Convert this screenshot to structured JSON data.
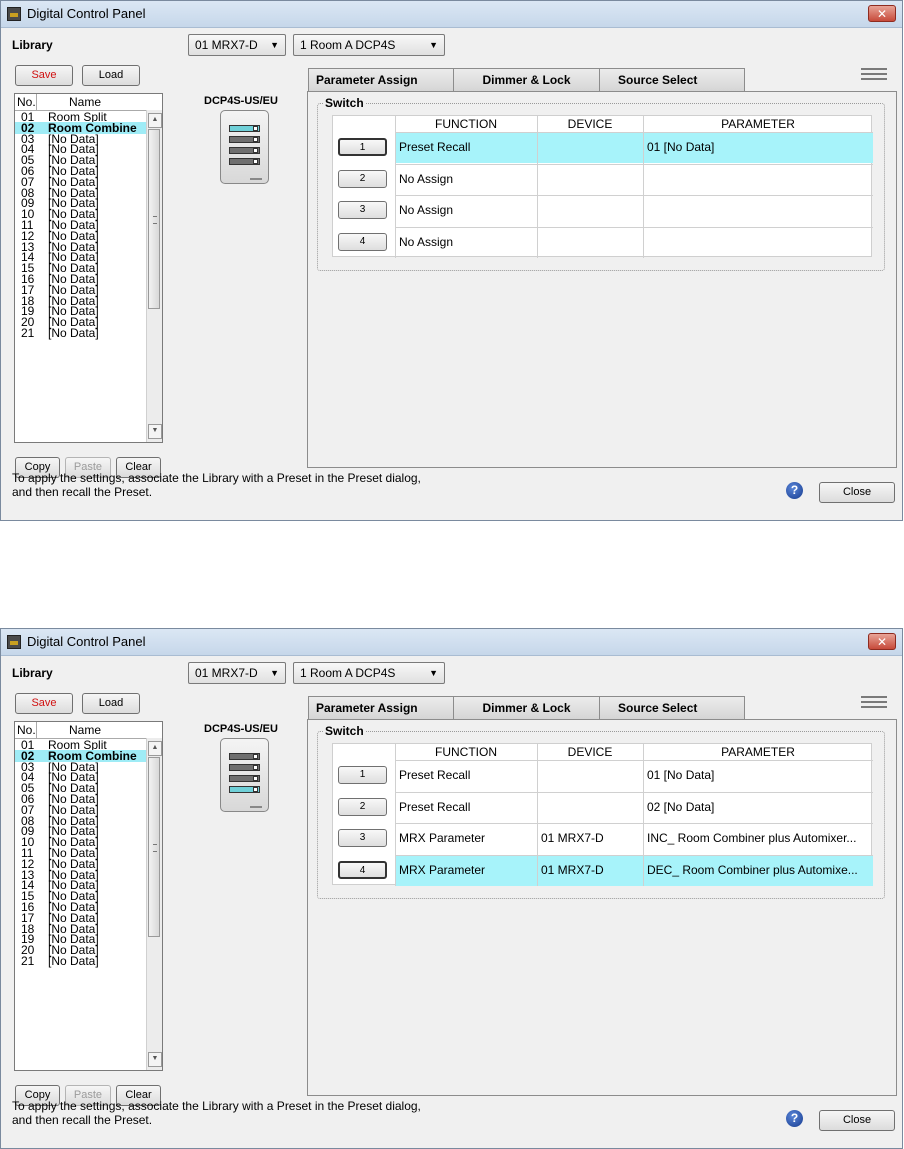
{
  "dialogs": [
    {
      "window_title": "Digital Control Panel",
      "library_label": "Library",
      "buttons": {
        "save": "Save",
        "load": "Load",
        "copy": "Copy",
        "paste": "Paste",
        "clear": "Clear",
        "close": "Close"
      },
      "combo_device": "01 MRX7-D",
      "combo_panel": "1 Room A DCP4S",
      "list_header": {
        "no": "No.",
        "name": "Name"
      },
      "library_items": [
        {
          "no": "01",
          "name": "Room Split"
        },
        {
          "no": "02",
          "name": "Room Combine"
        },
        {
          "no": "03",
          "name": "[No Data]"
        },
        {
          "no": "04",
          "name": "[No Data]"
        },
        {
          "no": "05",
          "name": "[No Data]"
        },
        {
          "no": "06",
          "name": "[No Data]"
        },
        {
          "no": "07",
          "name": "[No Data]"
        },
        {
          "no": "08",
          "name": "[No Data]"
        },
        {
          "no": "09",
          "name": "[No Data]"
        },
        {
          "no": "10",
          "name": "[No Data]"
        },
        {
          "no": "11",
          "name": "[No Data]"
        },
        {
          "no": "12",
          "name": "[No Data]"
        },
        {
          "no": "13",
          "name": "[No Data]"
        },
        {
          "no": "14",
          "name": "[No Data]"
        },
        {
          "no": "15",
          "name": "[No Data]"
        },
        {
          "no": "16",
          "name": "[No Data]"
        },
        {
          "no": "17",
          "name": "[No Data]"
        },
        {
          "no": "18",
          "name": "[No Data]"
        },
        {
          "no": "19",
          "name": "[No Data]"
        },
        {
          "no": "20",
          "name": "[No Data]"
        },
        {
          "no": "21",
          "name": "[No Data]"
        }
      ],
      "selected_item": 1,
      "model": "DCP4S-US/EU",
      "panel_lit_key": 1,
      "tabs": [
        "Parameter Assign",
        "Dimmer & Lock",
        "Source Select"
      ],
      "active_tab": 0,
      "group_label": "Switch",
      "table_headers": [
        "FUNCTION",
        "DEVICE",
        "PARAMETER"
      ],
      "switch_rows": [
        {
          "num": "1",
          "function": "Preset Recall",
          "device": "",
          "parameter": "01 [No Data]"
        },
        {
          "num": "2",
          "function": "No Assign",
          "device": "",
          "parameter": ""
        },
        {
          "num": "3",
          "function": "No Assign",
          "device": "",
          "parameter": ""
        },
        {
          "num": "4",
          "function": "No Assign",
          "device": "",
          "parameter": ""
        }
      ],
      "highlight_row": 0,
      "footer_line1": "To apply the settings, associate the Library with a Preset in the Preset dialog,",
      "footer_line2": "and then recall the Preset.",
      "help_symbol": "?"
    },
    {
      "window_title": "Digital Control Panel",
      "library_label": "Library",
      "buttons": {
        "save": "Save",
        "load": "Load",
        "copy": "Copy",
        "paste": "Paste",
        "clear": "Clear",
        "close": "Close"
      },
      "combo_device": "01 MRX7-D",
      "combo_panel": "1 Room A DCP4S",
      "list_header": {
        "no": "No.",
        "name": "Name"
      },
      "library_items": [
        {
          "no": "01",
          "name": "Room Split"
        },
        {
          "no": "02",
          "name": "Room Combine"
        },
        {
          "no": "03",
          "name": "[No Data]"
        },
        {
          "no": "04",
          "name": "[No Data]"
        },
        {
          "no": "05",
          "name": "[No Data]"
        },
        {
          "no": "06",
          "name": "[No Data]"
        },
        {
          "no": "07",
          "name": "[No Data]"
        },
        {
          "no": "08",
          "name": "[No Data]"
        },
        {
          "no": "09",
          "name": "[No Data]"
        },
        {
          "no": "10",
          "name": "[No Data]"
        },
        {
          "no": "11",
          "name": "[No Data]"
        },
        {
          "no": "12",
          "name": "[No Data]"
        },
        {
          "no": "13",
          "name": "[No Data]"
        },
        {
          "no": "14",
          "name": "[No Data]"
        },
        {
          "no": "15",
          "name": "[No Data]"
        },
        {
          "no": "16",
          "name": "[No Data]"
        },
        {
          "no": "17",
          "name": "[No Data]"
        },
        {
          "no": "18",
          "name": "[No Data]"
        },
        {
          "no": "19",
          "name": "[No Data]"
        },
        {
          "no": "20",
          "name": "[No Data]"
        },
        {
          "no": "21",
          "name": "[No Data]"
        }
      ],
      "selected_item": 1,
      "model": "DCP4S-US/EU",
      "panel_lit_key": 4,
      "tabs": [
        "Parameter Assign",
        "Dimmer & Lock",
        "Source Select"
      ],
      "active_tab": 0,
      "group_label": "Switch",
      "table_headers": [
        "FUNCTION",
        "DEVICE",
        "PARAMETER"
      ],
      "switch_rows": [
        {
          "num": "1",
          "function": "Preset Recall",
          "device": "",
          "parameter": "01 [No Data]"
        },
        {
          "num": "2",
          "function": "Preset Recall",
          "device": "",
          "parameter": "02 [No Data]"
        },
        {
          "num": "3",
          "function": "MRX Parameter",
          "device": "01 MRX7-D",
          "parameter": "INC_ Room Combiner plus Automixer..."
        },
        {
          "num": "4",
          "function": "MRX Parameter",
          "device": "01 MRX7-D",
          "parameter": "DEC_ Room Combiner plus Automixe..."
        }
      ],
      "highlight_row": 3,
      "footer_line1": "To apply the settings, associate the Library with a Preset in the Preset dialog,",
      "footer_line2": "and then recall the Preset.",
      "help_symbol": "?"
    }
  ]
}
